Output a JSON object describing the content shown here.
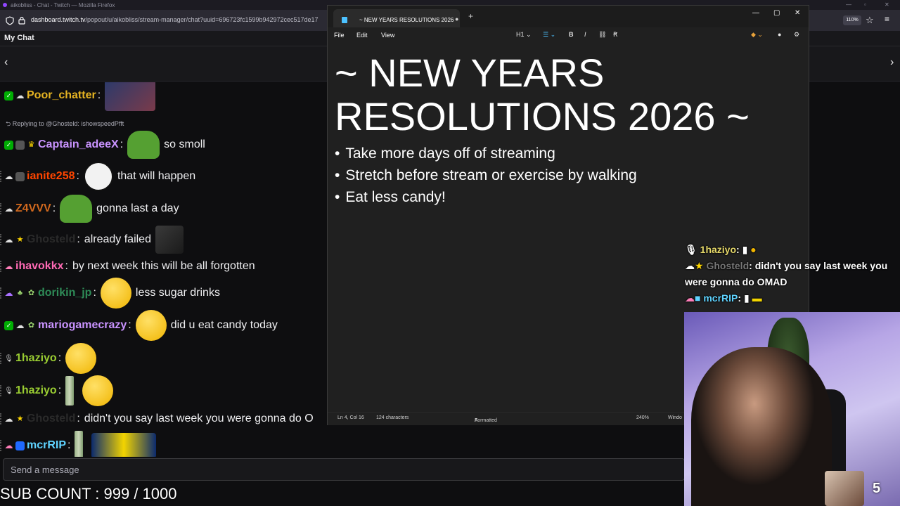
{
  "browser": {
    "window_title": "aikobliss - Chat - Twitch — Mozilla Firefox",
    "url_host": "dashboard.twitch.tv",
    "url_path": "/popout/u/aikobliss/stream-manager/chat?uuid=696723fc1599b942972cec517de17",
    "zoom": "110%"
  },
  "chat": {
    "header_title": "My Chat",
    "input_placeholder": "Send a message",
    "reply_label": "Replying to @Ghosteld: ishowspeedPfft",
    "messages": [
      {
        "user": "Poor_chatter",
        "color": "#e6b422",
        "text": ""
      },
      {
        "user": "Captain_adeeX",
        "color": "#c993ff",
        "text": "so smoll"
      },
      {
        "user": "ianite258",
        "color": "#ff4500",
        "text": "that will happen"
      },
      {
        "user": "Z4VVV",
        "color": "#d2691e",
        "text": "gonna last a day"
      },
      {
        "user": "Ghosteld",
        "color": "#2a2a2a",
        "text": "already failed"
      },
      {
        "user": "ihavokkx",
        "color": "#ff69b4",
        "text": "by next week this will be all forgotten"
      },
      {
        "user": "dorikin_jp",
        "color": "#2e8b57",
        "text": "less sugar drinks"
      },
      {
        "user": "mariogamecrazy",
        "color": "#c993ff",
        "text": "did u eat candy today"
      },
      {
        "user": "1haziyo",
        "color": "#9acd32",
        "text": ""
      },
      {
        "user": "1haziyo",
        "color": "#9acd32",
        "text": ""
      },
      {
        "user": "Ghosteld",
        "color": "#2a2a2a",
        "text": "didn't you say last week you were gonna do O"
      },
      {
        "user": "mcrRIP",
        "color": "#5fd3ff",
        "text": ""
      }
    ]
  },
  "stream": {
    "sub_count": "SUB COUNT : 999 / 1000",
    "webcam_number": "5"
  },
  "overlay_chat": [
    {
      "user": "1haziyo",
      "text": ""
    },
    {
      "user": "Ghosteld",
      "text": "didn't you say last week you were gonna do OMAD"
    },
    {
      "user": "mcrRIP",
      "text": ""
    }
  ],
  "notepad": {
    "tab_title": "~ NEW YEARS RESOLUTIONS 2026",
    "menu": [
      "File",
      "Edit",
      "View"
    ],
    "heading_style": "H1",
    "heading": "~ NEW YEARS RESOLUTIONS 2026 ~",
    "items": [
      "Take more days off of streaming",
      "Stretch before stream or exercise by walking",
      "Eat less candy!"
    ],
    "status": {
      "position": "Ln 4, Col 16",
      "characters": "124 characters",
      "mode": "Formatted",
      "zoom": "240%",
      "line_ending": "Windo"
    }
  }
}
